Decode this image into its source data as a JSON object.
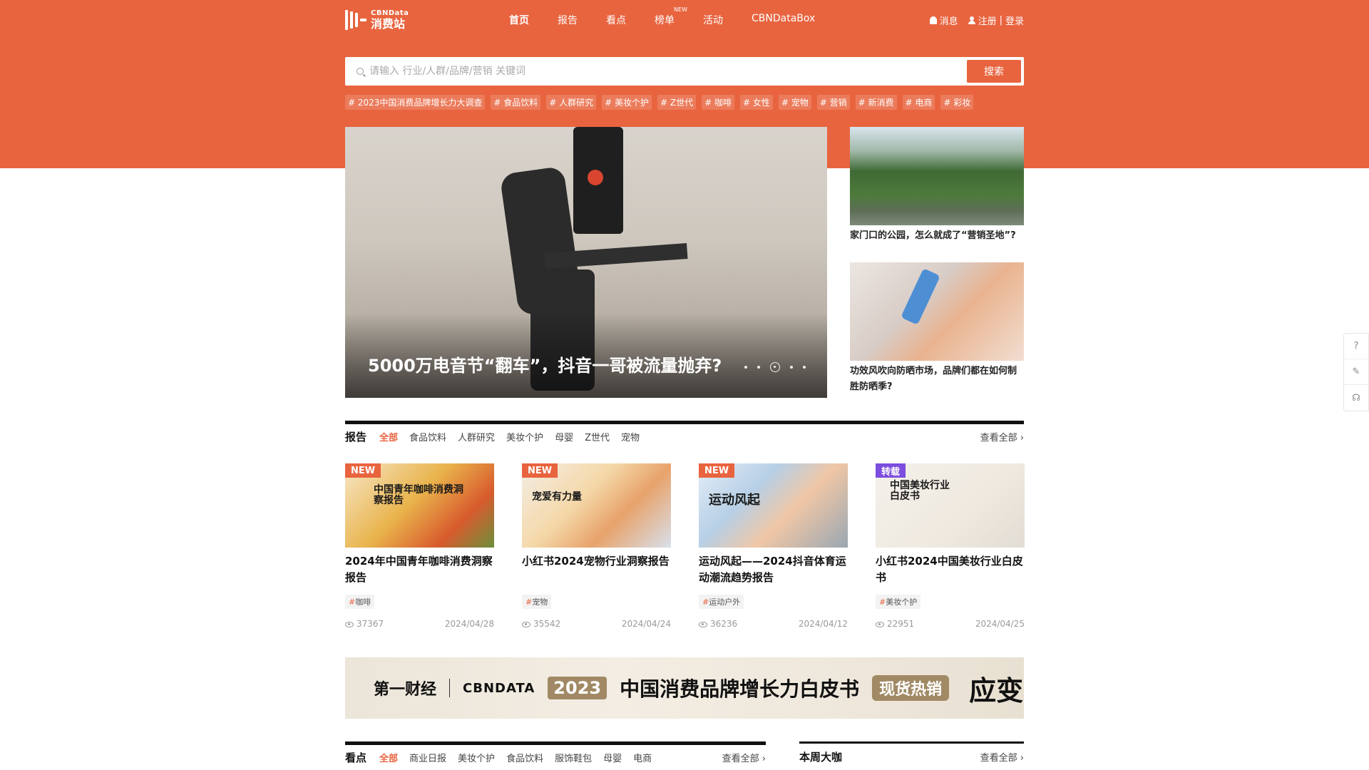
{
  "colors": {
    "brand": "#e8643f",
    "badge_new": "#e8643f",
    "badge_repost": "#7c4dde"
  },
  "header": {
    "logo_en": "CBNData",
    "logo_cn": "消费站",
    "nav": [
      {
        "label": "首页",
        "active": true
      },
      {
        "label": "报告"
      },
      {
        "label": "看点"
      },
      {
        "label": "榜单",
        "tag": "NEW"
      },
      {
        "label": "活动"
      },
      {
        "label": "CBNDataBox"
      }
    ],
    "messages_label": "消息",
    "register_label": "注册",
    "login_label": "登录",
    "divider": "|"
  },
  "search": {
    "placeholder": "请输入 行业/人群/品牌/营销 关键词",
    "button": "搜索"
  },
  "hot_tags": [
    "# 2023中国消费品牌增长力大调查",
    "# 食品饮料",
    "# 人群研究",
    "# 美妆个护",
    "# Z世代",
    "# 咖啡",
    "# 女性",
    "# 宠物",
    "# 营销",
    "# 新消费",
    "# 电商",
    "# 彩妆"
  ],
  "hero": {
    "title": "5000万电音节“翻车”，抖音一哥被流量抛弃?",
    "dots": 5,
    "active_dot": 3
  },
  "side_articles": [
    {
      "title": "家门口的公园，怎么就成了“营销圣地”?",
      "icon": "park-photo"
    },
    {
      "title": "功效风吹向防晒市场，品牌们都在如何制胜防晒季?",
      "icon": "sunscreen-photo"
    }
  ],
  "side_tools": [
    "help-icon",
    "feedback-icon",
    "support-icon"
  ],
  "reports": {
    "title": "报告",
    "tabs": [
      "全部",
      "食品饮料",
      "人群研究",
      "美妆个护",
      "母婴",
      "Z世代",
      "宠物"
    ],
    "more": "查看全部 ›",
    "items": [
      {
        "badge": "NEW",
        "image_text": "中国青年咖啡消费洞察报告",
        "title": "2024年中国青年咖啡消费洞察报告",
        "tag": "咖啡",
        "views": "37367",
        "date": "2024/04/28"
      },
      {
        "badge": "NEW",
        "image_text": "宠爱有力量",
        "title": "小红书2024宠物行业洞察报告",
        "tag": "宠物",
        "views": "35542",
        "date": "2024/04/24"
      },
      {
        "badge": "NEW",
        "image_text": "运动风起",
        "title": "运动风起——2024抖音体育运动潮流趋势报告",
        "tag": "运动户外",
        "views": "36236",
        "date": "2024/04/12"
      },
      {
        "badge": "转载",
        "image_text": "中国美妆行业白皮书",
        "title": "小红书2024中国美妆行业白皮书",
        "tag": "美妆个护",
        "views": "22951",
        "date": "2024/04/25"
      }
    ]
  },
  "banner": {
    "brand1": "第一财经",
    "brand2": "CBNDATA",
    "year": "2023",
    "title": "中国消费品牌增长力白皮书",
    "hot": "现货热销",
    "tail": "应变"
  },
  "kandian": {
    "title": "看点",
    "tabs": [
      "全部",
      "商业日报",
      "美妆个护",
      "食品饮料",
      "服饰鞋包",
      "母婴",
      "电商"
    ],
    "more": "查看全部 ›"
  },
  "weekly": {
    "title": "本周大咖",
    "more": "查看全部 ›"
  }
}
